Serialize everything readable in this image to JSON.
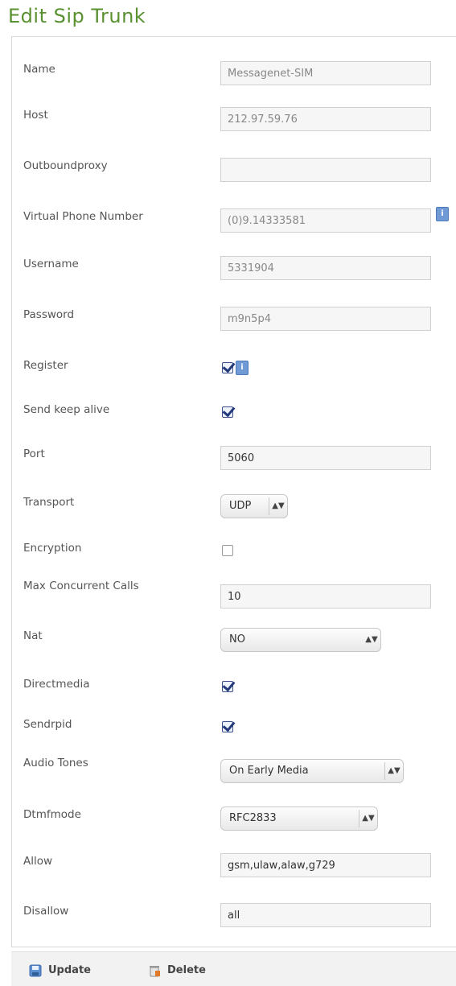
{
  "page_title": "Edit Sip Trunk",
  "fields": {
    "name": {
      "label": "Name",
      "value": "Messagenet-SIM"
    },
    "host": {
      "label": "Host",
      "value": "212.97.59.76"
    },
    "outboundproxy": {
      "label": "Outboundproxy",
      "value": ""
    },
    "virtual_phone": {
      "label": "Virtual Phone Number",
      "value": "(0)9.14333581"
    },
    "username": {
      "label": "Username",
      "value": "5331904"
    },
    "password": {
      "label": "Password",
      "value": "m9n5p4"
    },
    "register": {
      "label": "Register",
      "checked": true
    },
    "send_keep_alive": {
      "label": "Send keep alive",
      "checked": true
    },
    "port": {
      "label": "Port",
      "value": "5060"
    },
    "transport": {
      "label": "Transport",
      "value": "UDP"
    },
    "encryption": {
      "label": "Encryption",
      "checked": false
    },
    "max_calls": {
      "label": "Max Concurrent Calls",
      "value": "10"
    },
    "nat": {
      "label": "Nat",
      "value": "NO"
    },
    "directmedia": {
      "label": "Directmedia",
      "checked": true
    },
    "sendrpid": {
      "label": "Sendrpid",
      "checked": true
    },
    "audio_tones": {
      "label": "Audio Tones",
      "value": "On Early Media"
    },
    "dtmfmode": {
      "label": "Dtmfmode",
      "value": "RFC2833"
    },
    "allow": {
      "label": "Allow",
      "value": "gsm,ulaw,alaw,g729"
    },
    "disallow": {
      "label": "Disallow",
      "value": "all"
    }
  },
  "footer": {
    "update_label": "Update",
    "delete_label": "Delete"
  },
  "icons": {
    "info": "info-icon",
    "update": "save-icon",
    "delete": "trash-icon"
  },
  "colors": {
    "title": "#5a9130",
    "info_button": "#6f9ad6",
    "checkmark": "#243a7a"
  }
}
